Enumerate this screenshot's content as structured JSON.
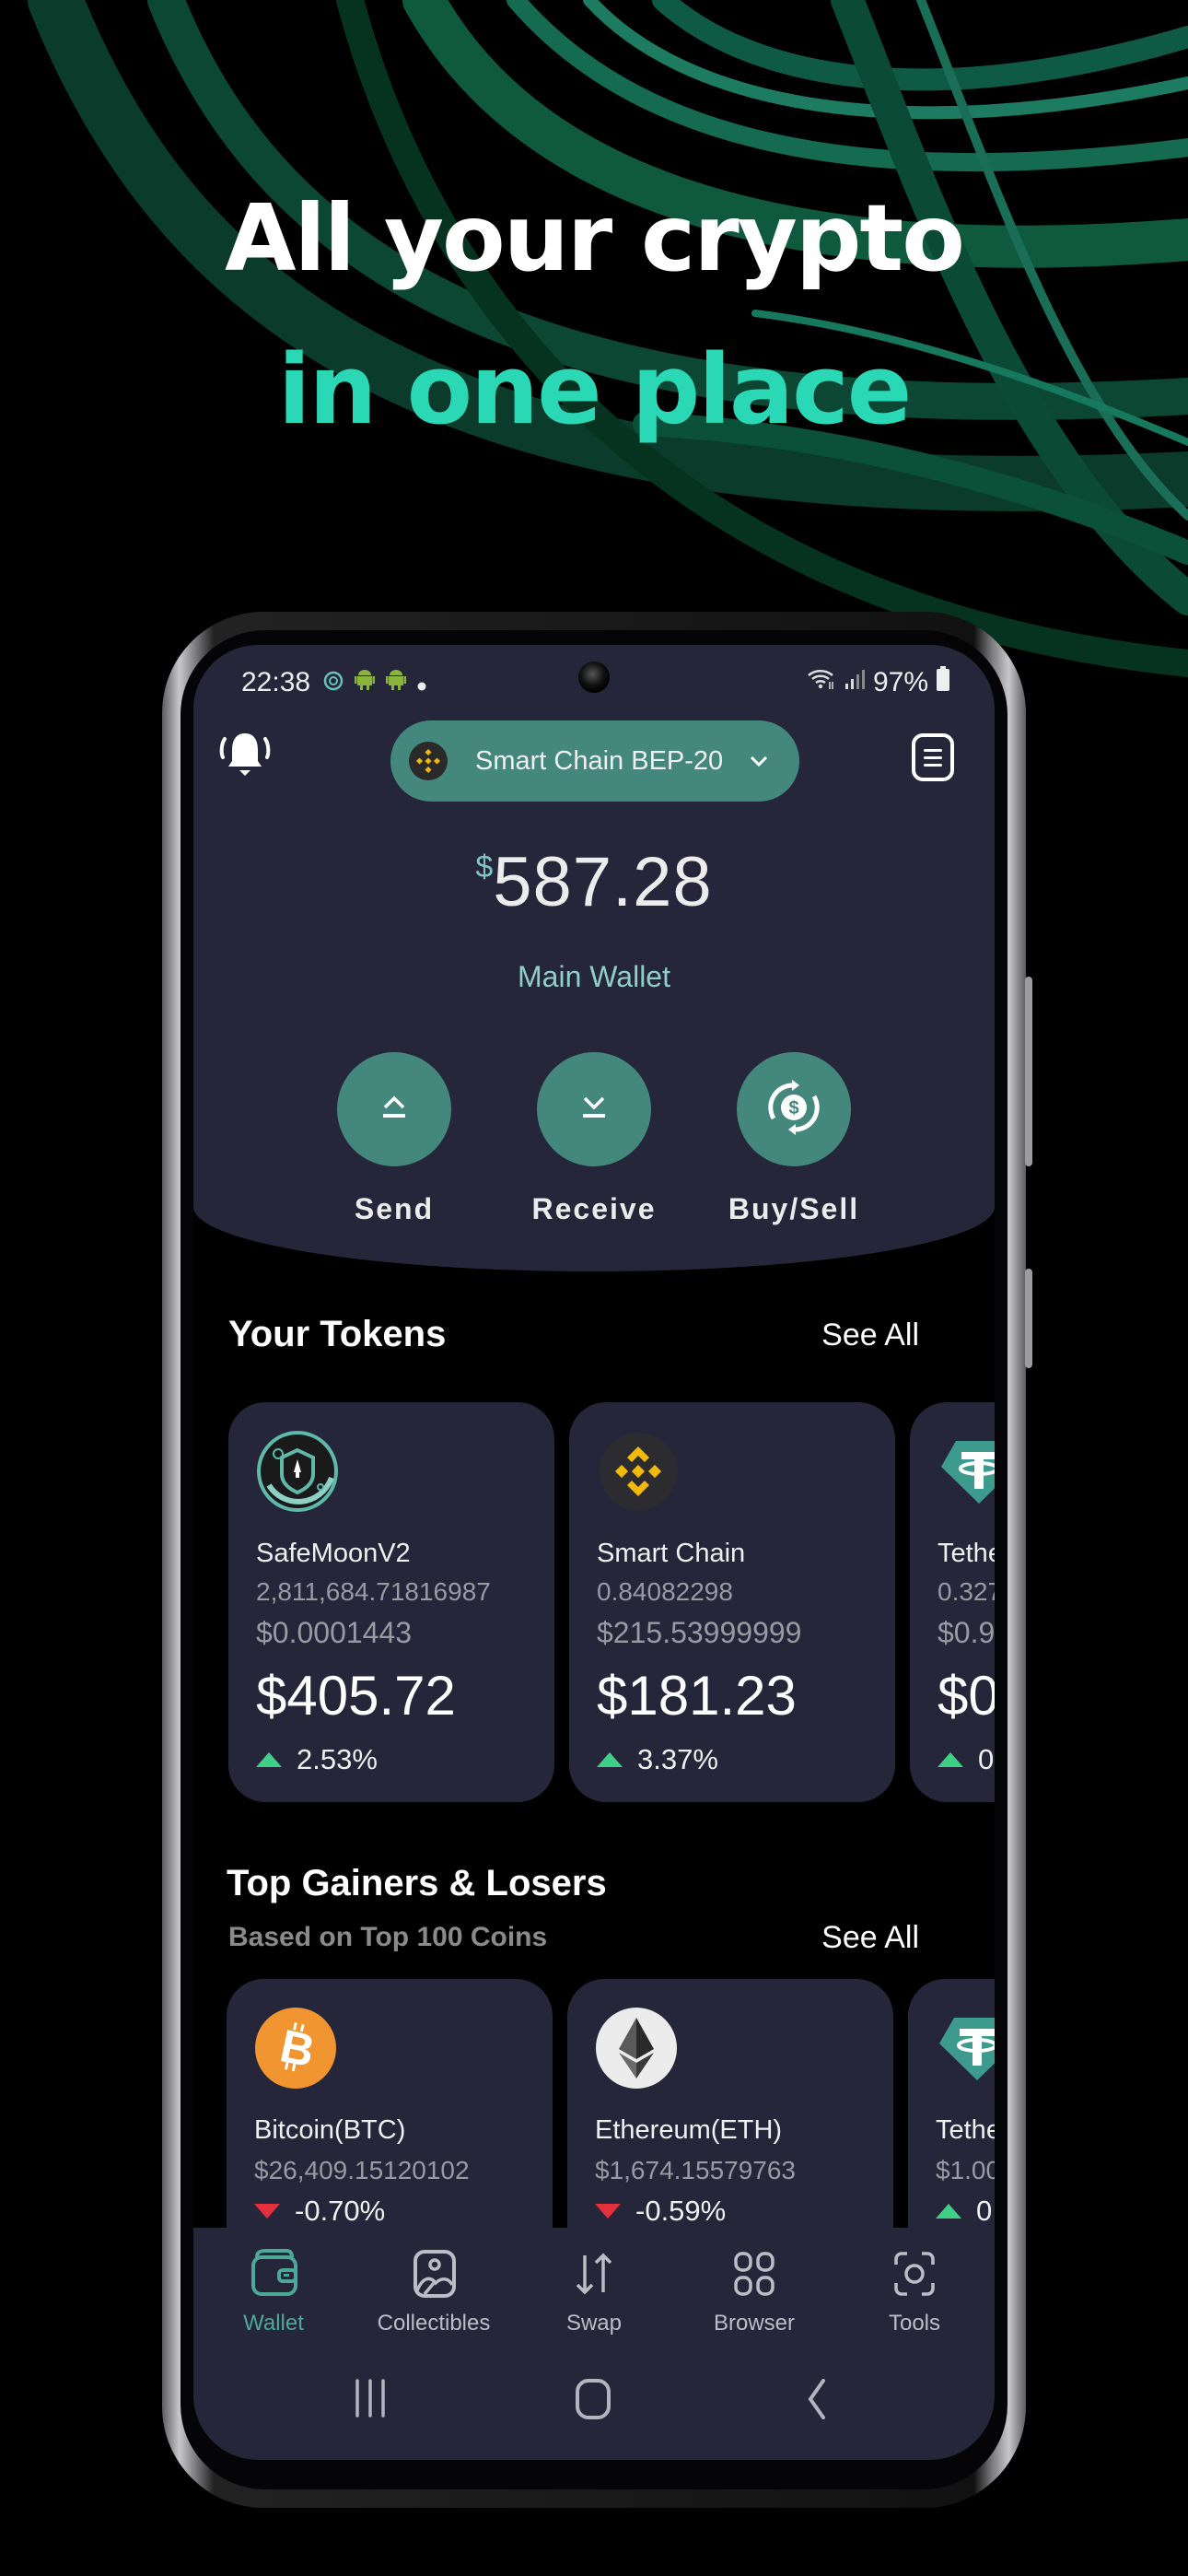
{
  "hero": {
    "line1": "All your crypto",
    "line2": "in one place"
  },
  "colors": {
    "accent": "#44877c",
    "hero_accent": "#2ad8b6",
    "panel": "#26263a",
    "positive": "#3fcf86",
    "negative": "#e3303c",
    "active_tab": "#4ea898"
  },
  "status_bar": {
    "time": "22:38",
    "battery": "97%",
    "icons": [
      "safemoon-notification-icon",
      "android-icon",
      "android-icon",
      "dot-icon",
      "wifi-icon",
      "signal-icon",
      "battery-icon"
    ]
  },
  "header": {
    "bell_icon": "bell-icon",
    "network_label": "Smart Chain BEP-20",
    "network_icon": "bnb-icon",
    "menu_icon": "menu-icon"
  },
  "wallet": {
    "currency_symbol": "$",
    "balance": "587.28",
    "name": "Main Wallet"
  },
  "actions": [
    {
      "label": "Send",
      "icon": "send-icon"
    },
    {
      "label": "Receive",
      "icon": "receive-icon"
    },
    {
      "label": "Buy/Sell",
      "icon": "buy-sell-icon"
    }
  ],
  "tokens_section": {
    "title": "Your Tokens",
    "see_all": "See All",
    "items": [
      {
        "name": "SafeMoonV2",
        "amount": "2,811,684.71816987",
        "price": "$0.0001443",
        "value": "$405.72",
        "change": "2.53%",
        "direction": "up",
        "icon": "safemoon-icon"
      },
      {
        "name": "Smart Chain",
        "amount": "0.84082298",
        "price": "$215.53999999",
        "value": "$181.23",
        "change": "3.37%",
        "direction": "up",
        "icon": "bnb-icon"
      },
      {
        "name": "Tethe",
        "amount": "0.327",
        "price": "$0.9",
        "value": "$0",
        "change": "0.",
        "direction": "up",
        "icon": "tether-icon"
      }
    ]
  },
  "gainers_section": {
    "title": "Top Gainers & Losers",
    "subtitle": "Based on Top 100 Coins",
    "see_all": "See All",
    "items": [
      {
        "name": "Bitcoin(BTC)",
        "price": "$26,409.15120102",
        "change": "-0.70%",
        "direction": "down",
        "icon": "bitcoin-icon"
      },
      {
        "name": "Ethereum(ETH)",
        "price": "$1,674.15579763",
        "change": "-0.59%",
        "direction": "down",
        "icon": "ethereum-icon"
      },
      {
        "name": "Tethe",
        "price": "$1.00",
        "change": "0.",
        "direction": "up",
        "icon": "tether-icon"
      }
    ]
  },
  "tab_bar": {
    "active": "Wallet",
    "tabs": [
      {
        "label": "Wallet",
        "icon": "wallet-icon"
      },
      {
        "label": "Collectibles",
        "icon": "collectibles-icon"
      },
      {
        "label": "Swap",
        "icon": "swap-icon"
      },
      {
        "label": "Browser",
        "icon": "browser-icon"
      },
      {
        "label": "Tools",
        "icon": "tools-icon"
      }
    ]
  },
  "system_nav": {
    "buttons": [
      "recents-icon",
      "home-icon",
      "back-icon"
    ]
  }
}
